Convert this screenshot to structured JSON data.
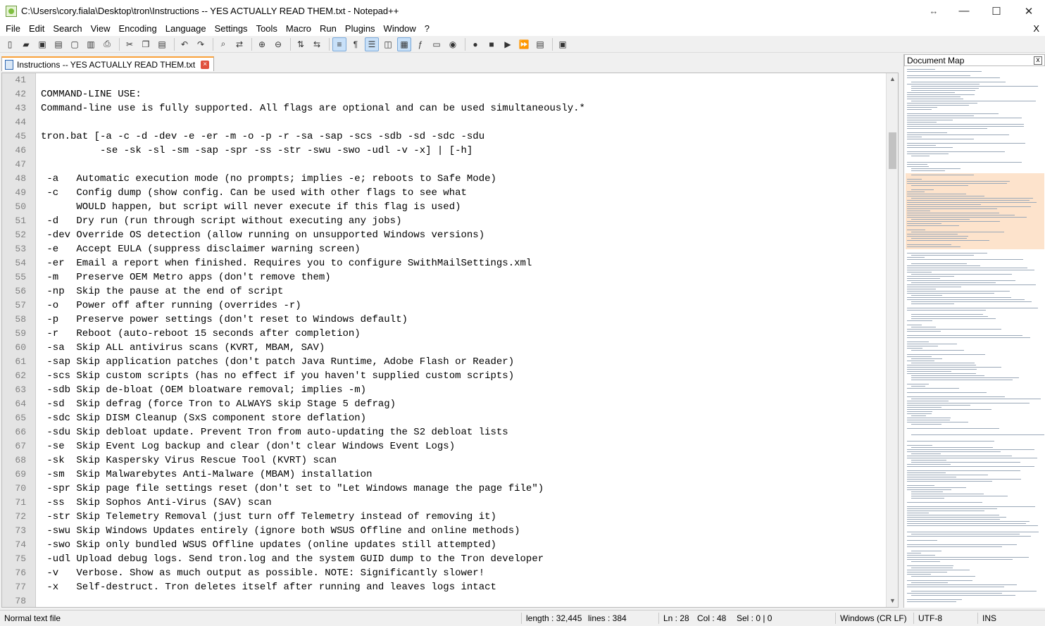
{
  "window": {
    "title": "C:\\Users\\cory.fiala\\Desktop\\tron\\Instructions -- YES ACTUALLY READ THEM.txt - Notepad++",
    "controls": {
      "minimize": "—",
      "maximize": "☐",
      "close": "✕",
      "resize": "↔"
    }
  },
  "menu": {
    "items": [
      "File",
      "Edit",
      "Search",
      "View",
      "Encoding",
      "Language",
      "Settings",
      "Tools",
      "Macro",
      "Run",
      "Plugins",
      "Window",
      "?"
    ],
    "close": "X"
  },
  "toolbar": {
    "icons": [
      "new-file-icon",
      "open-file-icon",
      "save-icon",
      "save-all-icon",
      "close-icon",
      "close-all-icon",
      "print-icon",
      "cut-icon",
      "copy-icon",
      "paste-icon",
      "undo-icon",
      "redo-icon",
      "find-icon",
      "replace-icon",
      "zoom-in-icon",
      "zoom-out-icon",
      "sync-vertical-icon",
      "sync-horizontal-icon",
      "word-wrap-icon",
      "show-all-chars-icon",
      "indent-guide-icon",
      "language-udl-icon",
      "document-map-icon",
      "function-list-icon",
      "folder-workspace-icon",
      "monitoring-icon",
      "record-macro-icon",
      "stop-record-icon",
      "playback-macro-icon",
      "run-macro-multiple-icon",
      "save-macro-icon",
      "launch-browser-icon"
    ]
  },
  "tab": {
    "label": "Instructions -- YES ACTUALLY READ THEM.txt"
  },
  "editor": {
    "lines": [
      {
        "n": "41",
        "t": ""
      },
      {
        "n": "42",
        "t": "COMMAND-LINE USE:"
      },
      {
        "n": "43",
        "t": "Command-line use is fully supported. All flags are optional and can be used simultaneously.*"
      },
      {
        "n": "44",
        "t": ""
      },
      {
        "n": "45",
        "t": "tron.bat [-a -c -d -dev -e -er -m -o -p -r -sa -sap -scs -sdb -sd -sdc -sdu"
      },
      {
        "n": "46",
        "t": "          -se -sk -sl -sm -sap -spr -ss -str -swu -swo -udl -v -x] | [-h]"
      },
      {
        "n": "47",
        "t": ""
      },
      {
        "n": "48",
        "t": " -a   Automatic execution mode (no prompts; implies -e; reboots to Safe Mode)"
      },
      {
        "n": "49",
        "t": " -c   Config dump (show config. Can be used with other flags to see what"
      },
      {
        "n": "50",
        "t": "      WOULD happen, but script will never execute if this flag is used)"
      },
      {
        "n": "51",
        "t": " -d   Dry run (run through script without executing any jobs)"
      },
      {
        "n": "52",
        "t": " -dev Override OS detection (allow running on unsupported Windows versions)"
      },
      {
        "n": "53",
        "t": " -e   Accept EULA (suppress disclaimer warning screen)"
      },
      {
        "n": "54",
        "t": " -er  Email a report when finished. Requires you to configure SwithMailSettings.xml"
      },
      {
        "n": "55",
        "t": " -m   Preserve OEM Metro apps (don't remove them)"
      },
      {
        "n": "56",
        "t": " -np  Skip the pause at the end of script"
      },
      {
        "n": "57",
        "t": " -o   Power off after running (overrides -r)"
      },
      {
        "n": "58",
        "t": " -p   Preserve power settings (don't reset to Windows default)"
      },
      {
        "n": "59",
        "t": " -r   Reboot (auto-reboot 15 seconds after completion)"
      },
      {
        "n": "60",
        "t": " -sa  Skip ALL antivirus scans (KVRT, MBAM, SAV)"
      },
      {
        "n": "61",
        "t": " -sap Skip application patches (don't patch Java Runtime, Adobe Flash or Reader)"
      },
      {
        "n": "62",
        "t": " -scs Skip custom scripts (has no effect if you haven't supplied custom scripts)"
      },
      {
        "n": "63",
        "t": " -sdb Skip de-bloat (OEM bloatware removal; implies -m)"
      },
      {
        "n": "64",
        "t": " -sd  Skip defrag (force Tron to ALWAYS skip Stage 5 defrag)"
      },
      {
        "n": "65",
        "t": " -sdc Skip DISM Cleanup (SxS component store deflation)"
      },
      {
        "n": "66",
        "t": " -sdu Skip debloat update. Prevent Tron from auto-updating the S2 debloat lists"
      },
      {
        "n": "67",
        "t": " -se  Skip Event Log backup and clear (don't clear Windows Event Logs)"
      },
      {
        "n": "68",
        "t": " -sk  Skip Kaspersky Virus Rescue Tool (KVRT) scan"
      },
      {
        "n": "69",
        "t": " -sm  Skip Malwarebytes Anti-Malware (MBAM) installation"
      },
      {
        "n": "70",
        "t": " -spr Skip page file settings reset (don't set to \"Let Windows manage the page file\")"
      },
      {
        "n": "71",
        "t": " -ss  Skip Sophos Anti-Virus (SAV) scan"
      },
      {
        "n": "72",
        "t": " -str Skip Telemetry Removal (just turn off Telemetry instead of removing it)"
      },
      {
        "n": "73",
        "t": " -swu Skip Windows Updates entirely (ignore both WSUS Offline and online methods)"
      },
      {
        "n": "74",
        "t": " -swo Skip only bundled WSUS Offline updates (online updates still attempted)"
      },
      {
        "n": "75",
        "t": " -udl Upload debug logs. Send tron.log and the system GUID dump to the Tron developer"
      },
      {
        "n": "76",
        "t": " -v   Verbose. Show as much output as possible. NOTE: Significantly slower!"
      },
      {
        "n": "77",
        "t": " -x   Self-destruct. Tron deletes itself after running and leaves logs intact"
      },
      {
        "n": "78",
        "t": ""
      }
    ]
  },
  "docmap": {
    "title": "Document Map",
    "close": "x"
  },
  "statusbar": {
    "file_type": "Normal text file",
    "length": "length : 32,445",
    "lines": "lines : 384",
    "ln": "Ln : 28",
    "col": "Col : 48",
    "sel": "Sel : 0 | 0",
    "eol": "Windows (CR LF)",
    "encoding": "UTF-8",
    "mode": "INS"
  },
  "colors": {
    "tab_accent": "#f9a13a",
    "docmap_highlight": "#fde3cc",
    "gutter": "#e4e4e4",
    "line_number": "#808080"
  }
}
